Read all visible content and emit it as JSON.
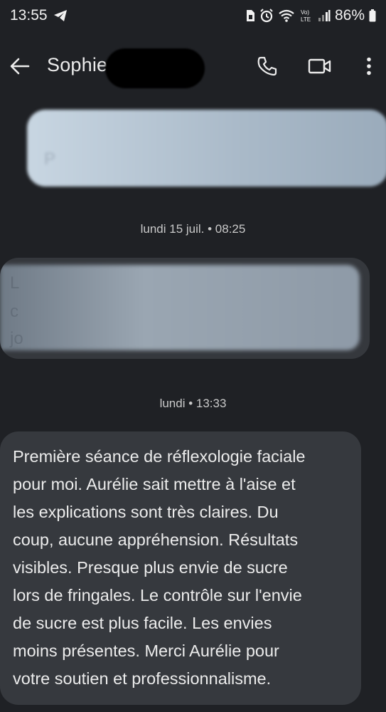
{
  "status_bar": {
    "time": "13:55",
    "battery": "86%",
    "network_label": "LTE",
    "icons": [
      "telegram-icon",
      "sim-icon",
      "alarm-icon",
      "wifi-icon",
      "volte-icon",
      "signal-icon",
      "battery-icon"
    ]
  },
  "header": {
    "contact_name": "Sophie",
    "actions": [
      "back-arrow-icon",
      "phone-icon",
      "video-camera-icon",
      "more-vert-icon"
    ]
  },
  "conversation": {
    "timestamps": [
      "lundi 15 juil. • 08:25",
      "lundi • 13:33"
    ],
    "blurred_bubble_1_hint": "P",
    "blurred_bubble_2_hint": [
      "L",
      "c",
      "jo"
    ],
    "message": "Première séance de réflexologie faciale\npour moi. Aurélie sait mettre à l'aise et\nles explications sont très claires. Du\ncoup, aucune appréhension. Résultats\nvisibles. Presque plus envie de sucre\nlors de fringales. Le contrôle sur l'envie\nde sucre est plus facile. Les envies\nmoins présentes. Merci Aurélie pour\nvotre soutien et professionnalisme."
  },
  "colors": {
    "background": "#1f2125",
    "bubble": "#36393e",
    "text": "#ececec"
  }
}
